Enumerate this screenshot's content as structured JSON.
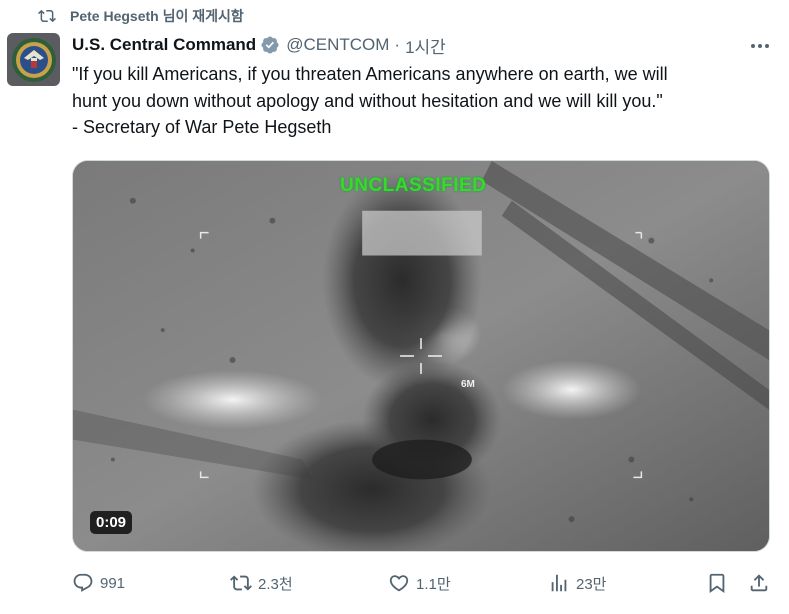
{
  "repost": {
    "text": "Pete Hegseth 님이 재게시함",
    "icon": "repost-icon"
  },
  "tweet": {
    "display_name": "U.S. Central Command",
    "handle": "@CENTCOM",
    "separator": "·",
    "time": "1시간",
    "text_lines": [
      "\"If you kill Americans, if you threaten Americans anywhere on earth, we will",
      "hunt you down without apology and without hesitation and we will kill you.\"",
      "- Secretary of War Pete Hegseth"
    ]
  },
  "media": {
    "overlay_label": "UNCLASSIFIED",
    "range_label": "6M",
    "duration": "0:09"
  },
  "actions": {
    "replies": "991",
    "reposts": "2.3천",
    "likes": "1.1만",
    "views": "23만"
  },
  "colors": {
    "text_primary": "#0f1419",
    "text_secondary": "#536471",
    "verified_badge": "#829aab",
    "overlay_green": "#39d82a"
  }
}
